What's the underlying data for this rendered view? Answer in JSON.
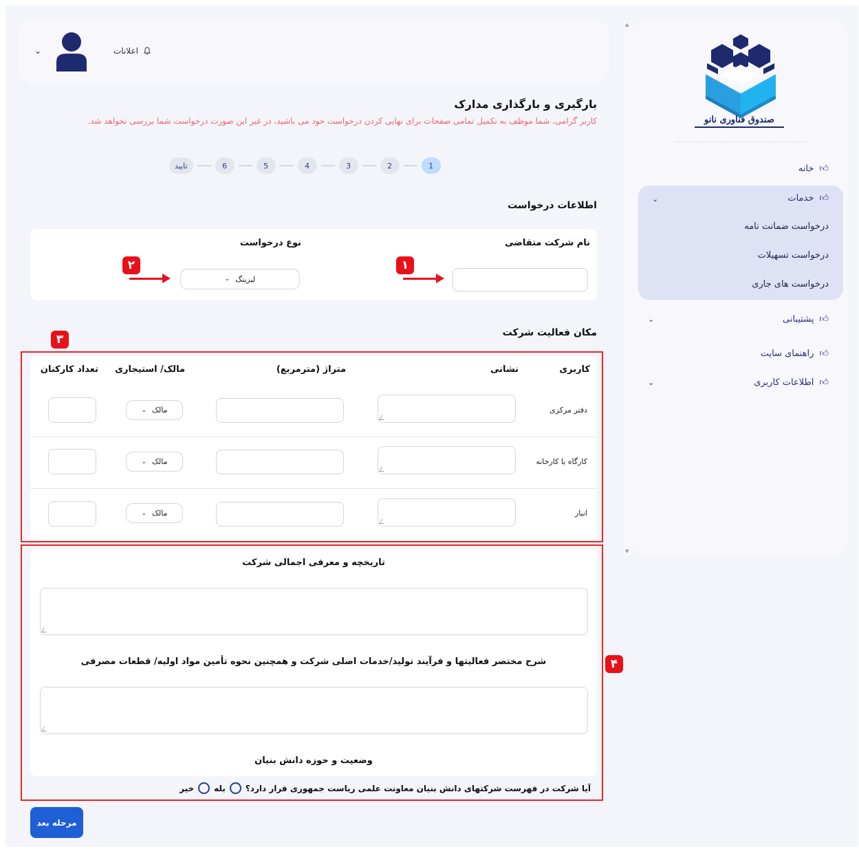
{
  "sidebar": {
    "logo_text": "صندوق فناوری نانو",
    "items": [
      {
        "label": "خانه"
      },
      {
        "label": "خدمات"
      },
      {
        "label": "پشتیبانی"
      },
      {
        "label": "راهنمای سایت"
      },
      {
        "label": "اطلاعات کاربری"
      }
    ],
    "services_sub": [
      {
        "label": "درخواست ضمانت نامه"
      },
      {
        "label": "درخواست تسهیلات"
      },
      {
        "label": "درخواست های جاری"
      }
    ],
    "icon": "hand-icon",
    "active_bg": "#dfe1f4"
  },
  "header": {
    "notifications_label": "اعلانات",
    "notifications_icon": "bell-icon",
    "avatar_icon": "user-avatar-icon",
    "avatar_color": "#1e2a6e"
  },
  "page": {
    "title": "بارگیری و بارگذاری مدارک",
    "warning": "کاربر گرامی، شما موظف به تکمیل تمامی صفحات برای نهایی کردن درخواست خود می باشید، در غیر این صورت درخواست شما بررسی نخواهد شد.",
    "steps": [
      "1",
      "2",
      "3",
      "4",
      "5",
      "6",
      "تایید"
    ],
    "active_step": "1"
  },
  "request_info": {
    "section_title": "اطلاعات درخواست",
    "company_label": "نام شرکت متقاضی",
    "company_value": "",
    "type_label": "نوع درخواست",
    "type_value": "لیزینگ"
  },
  "location": {
    "section_title": "مکان فعالیت شرکت",
    "headers": [
      "کاربری",
      "نشانی",
      "متراژ (مترمربع)",
      "مالک/ استیجاری",
      "تعداد کارکنان"
    ],
    "rows": [
      {
        "label": "دفتر مرکزی",
        "ownership": "مالک"
      },
      {
        "label": "کارگاه یا کارخانه",
        "ownership": "مالک"
      },
      {
        "label": "انبار",
        "ownership": "مالک"
      }
    ]
  },
  "about": {
    "history_label": "تاریخچه و معرفی اجمالی شرکت",
    "activities_label": "شرح مختصر فعالیتها و فرآیند تولید/خدمات اصلی شرکت و همچنین نحوه تأمین مواد اولیه/ قطعات مصرفی",
    "kb_label": "وضعیت و حوزه دانش بنیان",
    "kb_question": "آیا شرکت در فهرست شرکتهای دانش بنیان معاونت علمی ریاست جمهوری قرار دارد؟",
    "yes": "بله",
    "no": "خیر"
  },
  "annotations": {
    "badges": [
      "۱",
      "۲",
      "۳",
      "۴"
    ],
    "color": "#e8111a"
  },
  "footer": {
    "next_label": "مرحله بعد",
    "next_color": "#1f5fd6"
  }
}
